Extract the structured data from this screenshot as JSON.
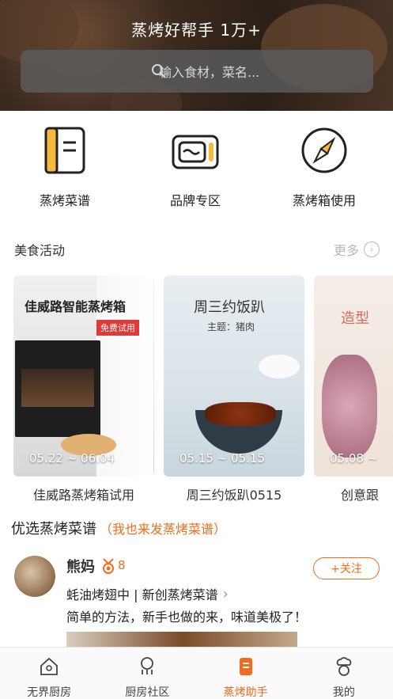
{
  "header": {
    "title": "蒸烤好帮手 1万+",
    "search_placeholder": "输入食材，菜名..."
  },
  "categories": [
    {
      "label": "蒸烤菜谱",
      "icon": "recipe-book-icon"
    },
    {
      "label": "品牌专区",
      "icon": "oven-icon"
    },
    {
      "label": "蒸烤箱使用",
      "icon": "compass-icon"
    }
  ],
  "activities": {
    "title": "美食活动",
    "more": "更多",
    "cards": [
      {
        "image_title": "佳威路智能蒸烤箱",
        "badge": "免费试用",
        "date": "05.22 ~ 06.04",
        "caption": "佳威路蒸烤箱试用"
      },
      {
        "image_title": "周三约饭趴",
        "image_subtitle": "主题：猪肉",
        "date": "05.15 ~ 05.15",
        "caption": "周三约饭趴0515"
      },
      {
        "image_title": "造型",
        "date": "05.08 ~",
        "caption": "创意跟"
      }
    ]
  },
  "recipes": {
    "title": "优选蒸烤菜谱",
    "subtitle": "（我也来发蒸烤菜谱）",
    "post": {
      "user": "熊妈",
      "level": "8",
      "follow": "+关注",
      "title": "蚝油烤翅中 | 新创蒸烤菜谱",
      "description": "简单的方法，新手也做的来，味道美极了！"
    }
  },
  "tabbar": [
    {
      "label": "无界厨房",
      "icon": "house-icon",
      "active": false
    },
    {
      "label": "厨房社区",
      "icon": "community-icon",
      "active": false
    },
    {
      "label": "蒸烤助手",
      "icon": "assistant-icon",
      "active": true
    },
    {
      "label": "我的",
      "icon": "chef-icon",
      "active": false
    }
  ],
  "colors": {
    "accent": "#f46b1d",
    "icon_yellow": "#f6b93b"
  }
}
